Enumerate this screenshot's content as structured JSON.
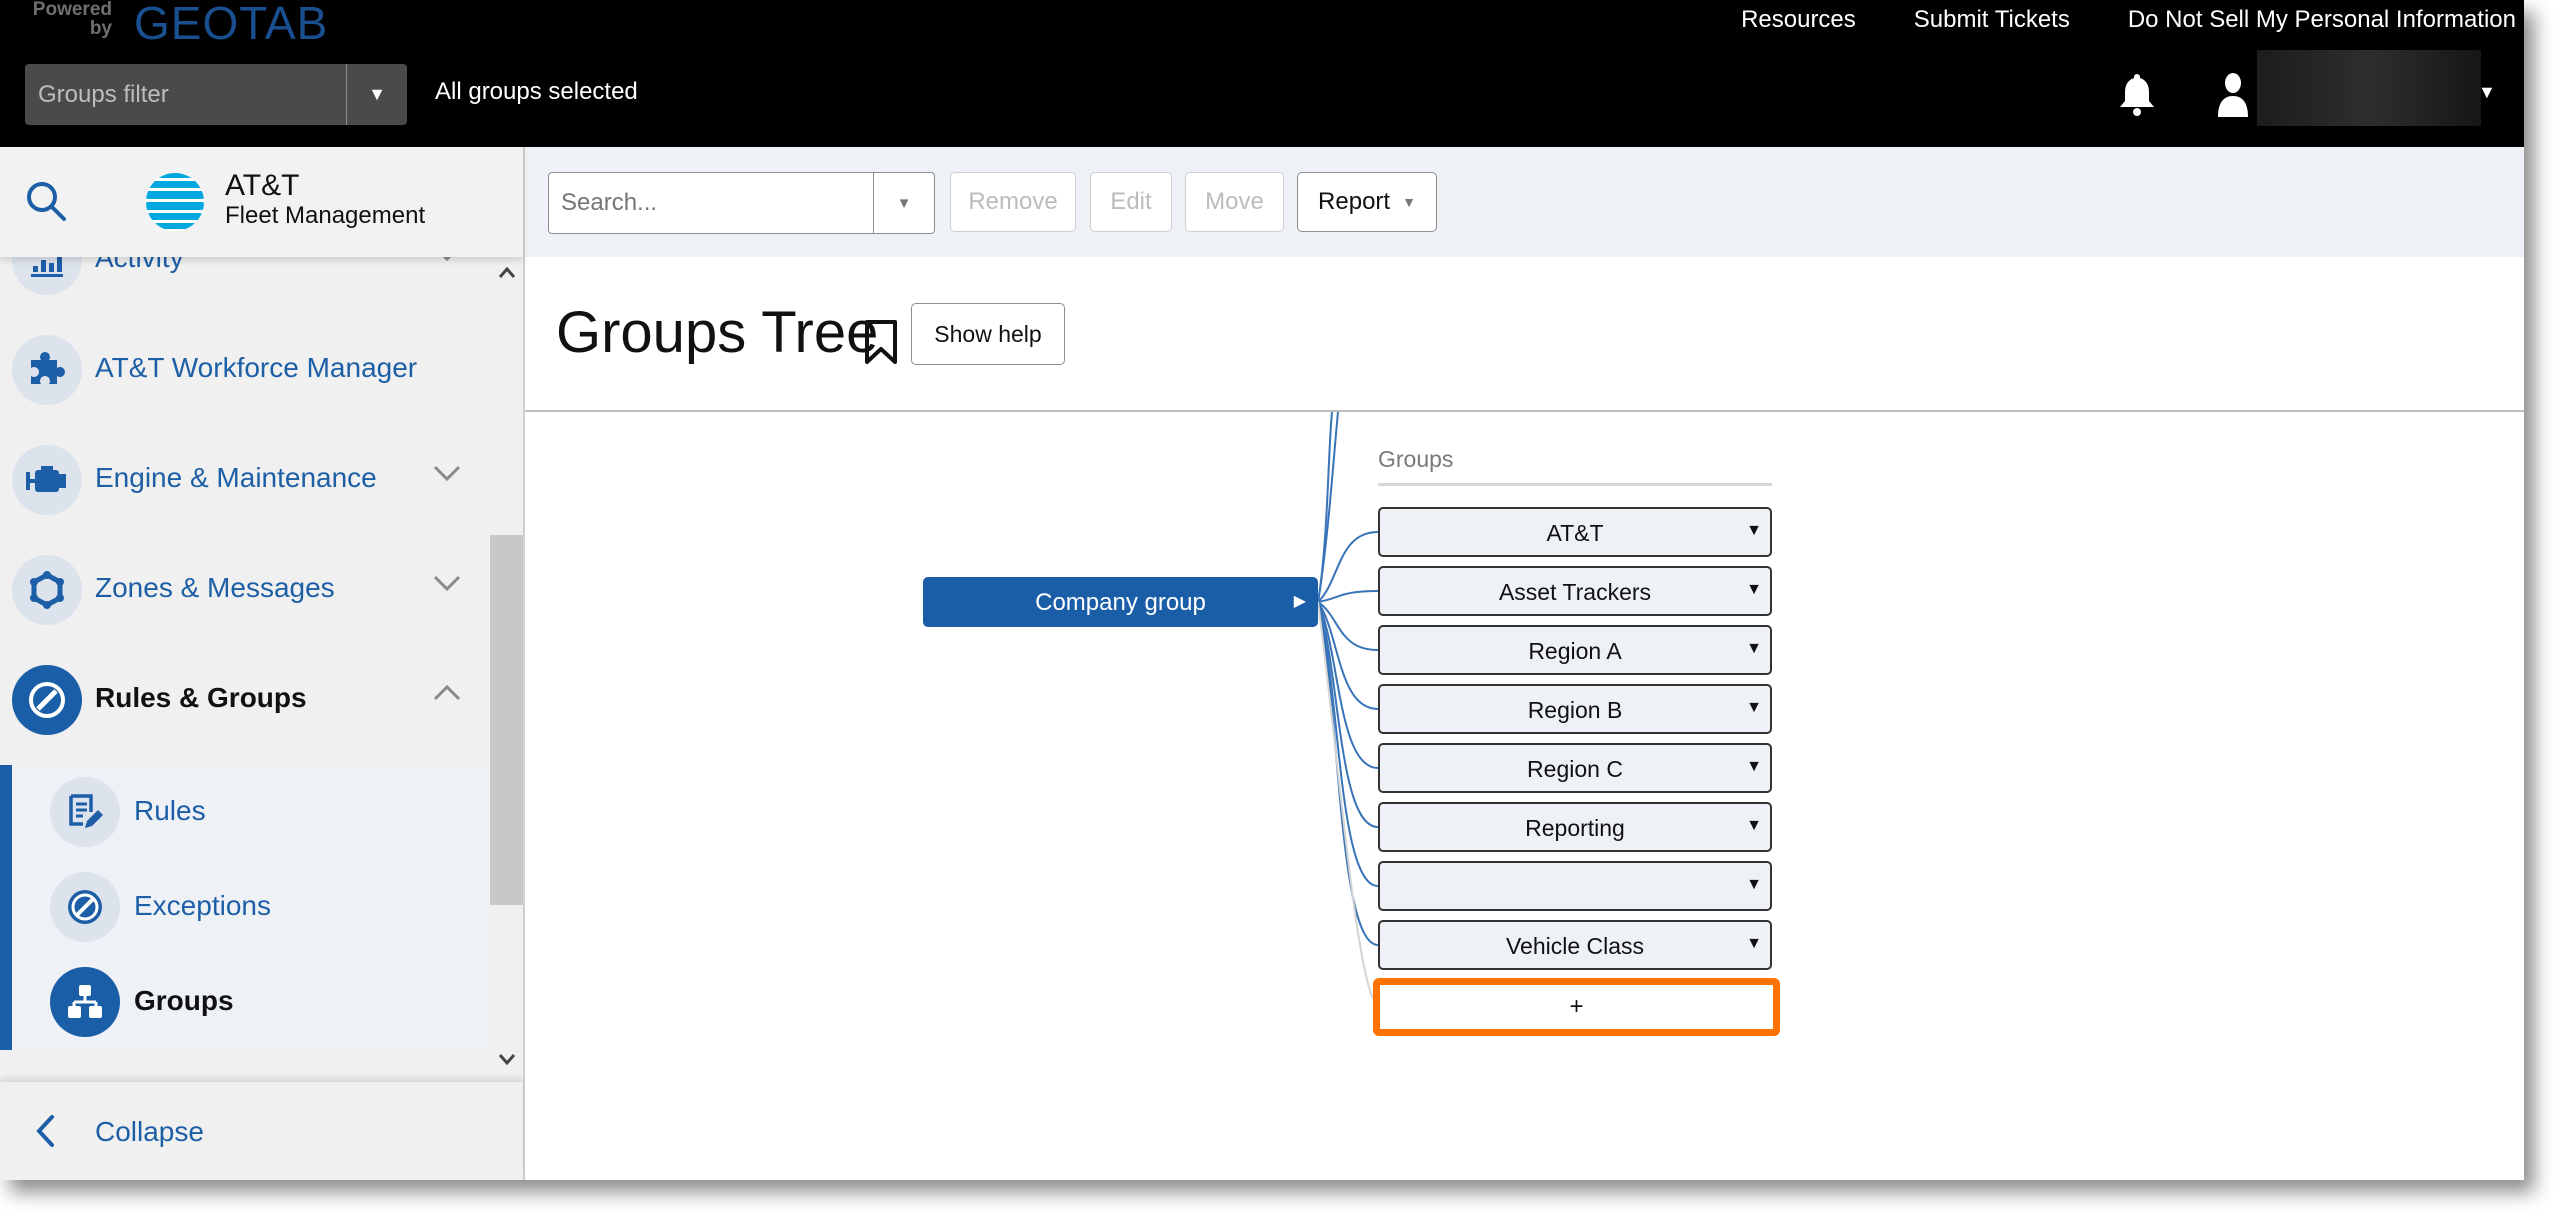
{
  "header": {
    "powered_by": "Powered by",
    "brand": "GEOTAB",
    "links": [
      "Resources",
      "Submit Tickets",
      "Do Not Sell My Personal Information"
    ],
    "groups_filter_placeholder": "Groups filter",
    "groups_status": "All groups selected",
    "user_name": ""
  },
  "sidebar": {
    "logo_title": "AT&T",
    "logo_subtitle": "Fleet Management",
    "items": [
      {
        "label": "Activity",
        "icon": "activity-icon",
        "expanded": false
      },
      {
        "label": "AT&T Workforce Manager",
        "icon": "puzzle-icon"
      },
      {
        "label": "Engine & Maintenance",
        "icon": "engine-icon",
        "expanded": false
      },
      {
        "label": "Zones & Messages",
        "icon": "zones-icon",
        "expanded": false
      },
      {
        "label": "Rules & Groups",
        "icon": "rules-groups-icon",
        "expanded": true,
        "active": true
      }
    ],
    "subitems": [
      {
        "label": "Rules",
        "icon": "rules-icon"
      },
      {
        "label": "Exceptions",
        "icon": "exceptions-icon"
      },
      {
        "label": "Groups",
        "icon": "groups-icon",
        "active": true
      }
    ],
    "collapse_label": "Collapse"
  },
  "toolbar": {
    "search_placeholder": "Search...",
    "remove_label": "Remove",
    "edit_label": "Edit",
    "move_label": "Move",
    "report_label": "Report"
  },
  "page": {
    "title": "Groups Tree",
    "show_help_label": "Show help"
  },
  "tree": {
    "root_label": "Company group",
    "column_header": "Groups",
    "nodes": [
      "AT&T",
      "Asset Trackers",
      "Region A",
      "Region B",
      "Region C",
      "Reporting",
      "",
      "Vehicle Class"
    ],
    "add_label": "+"
  },
  "colors": {
    "brand_blue": "#1a5ea8",
    "highlight_orange": "#ff7300",
    "header_bg": "#000000",
    "toolbar_bg": "#eef1f6"
  }
}
